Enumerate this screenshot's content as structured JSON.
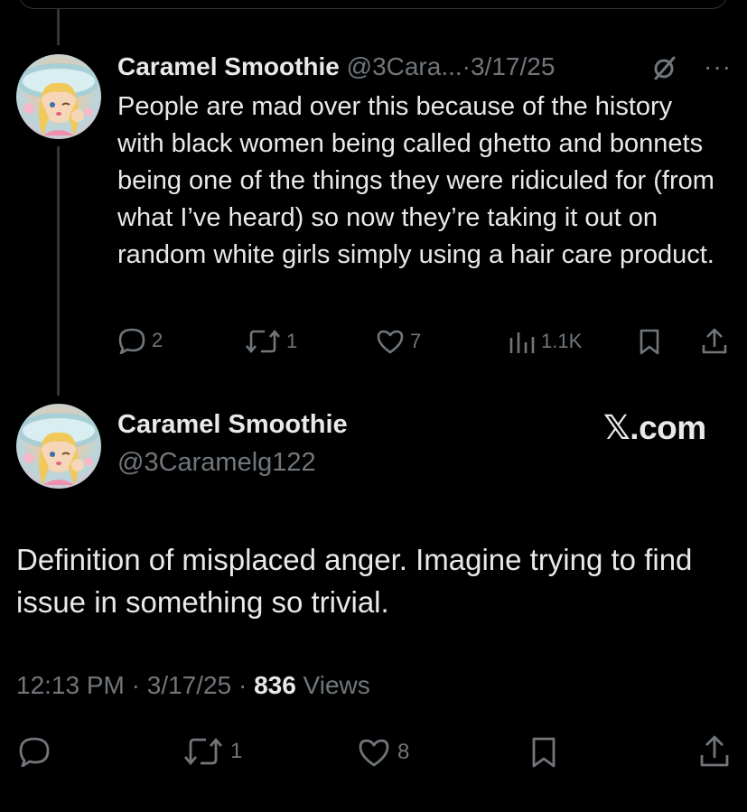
{
  "reply": {
    "author_name": "Caramel Smoothie",
    "handle": "@3Cara...",
    "separator": "·",
    "date": "3/17/25",
    "grok_icon": "grok-slash-icon",
    "more_icon": "more-dots-icon",
    "more_glyph": "···",
    "text": "People are mad over this because of the history with black women being called ghetto and bonnets being one of the things they were ridiculed for (from what I’ve heard) so now they’re taking it out on random white girls simply using a hair care product.",
    "actions": {
      "replies": "2",
      "reposts": "1",
      "likes": "7",
      "views": "1.1K"
    }
  },
  "main": {
    "author_name": "Caramel Smoothie",
    "handle": "@3Caramelg122",
    "brand": "𝕏.com",
    "text": "Definition of misplaced anger. Imagine trying to find issue in something so trivial.",
    "time": "12:13 PM",
    "sep1": " · ",
    "date": "3/17/25",
    "sep2": " · ",
    "views_count": "836",
    "views_label": " Views",
    "actions": {
      "reposts": "1",
      "likes": "8"
    }
  },
  "colors": {
    "background": "#000000",
    "text": "#e7e9ea",
    "muted": "#71767b",
    "thread_line": "#333639"
  }
}
